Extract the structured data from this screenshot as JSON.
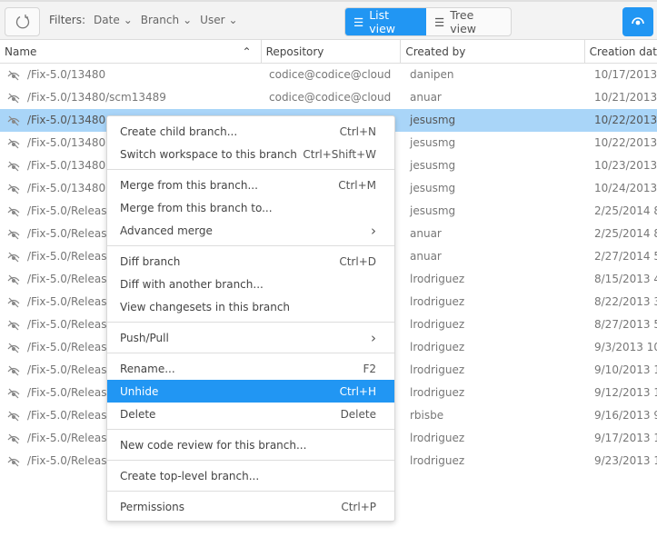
{
  "toolbar": {
    "filters_label": "Filters:",
    "filters": [
      "Date",
      "Branch",
      "User"
    ],
    "list_view": "List view",
    "tree_view": "Tree view",
    "accent": "#2196f3"
  },
  "columns": [
    "Name",
    "Repository",
    "Created by",
    "Creation dat"
  ],
  "rows": [
    {
      "name": "/Fix-5.0/13480",
      "repo": "codice@codice@cloud",
      "by": "danipen",
      "date": "10/17/2013 2"
    },
    {
      "name": "/Fix-5.0/13480/scm13489",
      "repo": "codice@codice@cloud",
      "by": "anuar",
      "date": "10/21/2013 2"
    },
    {
      "name": "/Fix-5.0/13480",
      "repo": "",
      "by": "jesusmg",
      "date": "10/22/2013",
      "selected": true
    },
    {
      "name": "/Fix-5.0/13480",
      "repo": "",
      "by": "jesusmg",
      "date": "10/22/2013"
    },
    {
      "name": "/Fix-5.0/13480",
      "repo": "",
      "by": "jesusmg",
      "date": "10/23/2013"
    },
    {
      "name": "/Fix-5.0/13480",
      "repo": "",
      "by": "jesusmg",
      "date": "10/24/2013"
    },
    {
      "name": "/Fix-5.0/Releas",
      "repo": "",
      "by": "jesusmg",
      "date": "2/25/2014 8"
    },
    {
      "name": "/Fix-5.0/Releas",
      "repo": "",
      "by": "anuar",
      "date": "2/25/2014 8"
    },
    {
      "name": "/Fix-5.0/Releas",
      "repo": "",
      "by": "anuar",
      "date": "2/27/2014 5"
    },
    {
      "name": "/Fix-5.0/Releas",
      "repo": "",
      "by": "lrodriguez",
      "date": "8/15/2013 4"
    },
    {
      "name": "/Fix-5.0/Releas",
      "repo": "",
      "by": "lrodriguez",
      "date": "8/22/2013 3"
    },
    {
      "name": "/Fix-5.0/Releas",
      "repo": "",
      "by": "lrodriguez",
      "date": "8/27/2013 5"
    },
    {
      "name": "/Fix-5.0/Releas",
      "repo": "",
      "by": "lrodriguez",
      "date": "9/3/2013 10"
    },
    {
      "name": "/Fix-5.0/Releas",
      "repo": "",
      "by": "lrodriguez",
      "date": "9/10/2013 1"
    },
    {
      "name": "/Fix-5.0/Releas",
      "repo": "",
      "by": "lrodriguez",
      "date": "9/12/2013 1"
    },
    {
      "name": "/Fix-5.0/Releas",
      "repo": "",
      "by": "rbisbe",
      "date": "9/16/2013 9"
    },
    {
      "name": "/Fix-5.0/Releas",
      "repo": "",
      "by": "lrodriguez",
      "date": "9/17/2013 1"
    },
    {
      "name": "/Fix-5.0/Releas",
      "repo": "",
      "by": "lrodriguez",
      "date": "9/23/2013 1"
    }
  ],
  "menu": [
    [
      {
        "label": "Create child branch...",
        "key": "Ctrl+N"
      },
      {
        "label": "Switch workspace to this branch",
        "key": "Ctrl+Shift+W"
      }
    ],
    [
      {
        "label": "Merge from this branch...",
        "key": "Ctrl+M"
      },
      {
        "label": "Merge from this branch to...",
        "key": ""
      },
      {
        "label": "Advanced merge",
        "key": "",
        "submenu": true
      }
    ],
    [
      {
        "label": "Diff branch",
        "key": "Ctrl+D"
      },
      {
        "label": "Diff with another branch...",
        "key": ""
      },
      {
        "label": "View changesets in this branch",
        "key": ""
      }
    ],
    [
      {
        "label": "Push/Pull",
        "key": "",
        "submenu": true
      }
    ],
    [
      {
        "label": "Rename...",
        "key": "F2"
      },
      {
        "label": "Unhide",
        "key": "Ctrl+H",
        "highlighted": true
      },
      {
        "label": "Delete",
        "key": "Delete"
      }
    ],
    [
      {
        "label": "New code review for this branch...",
        "key": ""
      }
    ],
    [
      {
        "label": "Create top-level branch...",
        "key": ""
      }
    ],
    [
      {
        "label": "Permissions",
        "key": "Ctrl+P"
      }
    ]
  ]
}
